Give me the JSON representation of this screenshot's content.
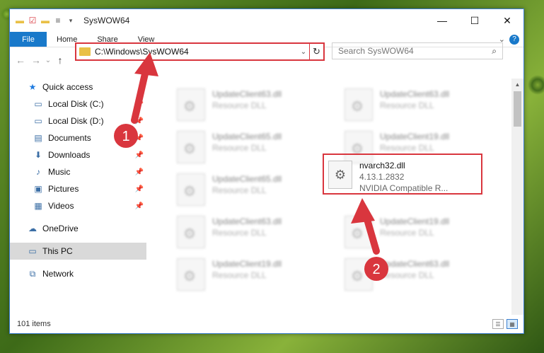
{
  "window": {
    "title": "SysWOW64"
  },
  "quick_access_toolbar": {
    "icons": [
      "folder-icon",
      "properties-check-icon",
      "new-folder-icon",
      "customize-dropdown-icon"
    ]
  },
  "window_controls": {
    "minimize": "—",
    "maximize": "☐",
    "close": "✕"
  },
  "ribbon": {
    "tabs": [
      "File",
      "Home",
      "Share",
      "View"
    ],
    "expand": "⌄",
    "help": "?"
  },
  "nav": {
    "back": "←",
    "forward": "→",
    "recent": "⌄",
    "up": "↑"
  },
  "address": {
    "path": "C:\\Windows\\SysWOW64",
    "dropdown": "⌄",
    "refresh": "↻"
  },
  "search": {
    "placeholder": "Search SysWOW64",
    "icon": "⌕"
  },
  "sidebar": {
    "items": [
      {
        "label": "Quick access",
        "icon": "star-icon",
        "glyph": "★",
        "color": "#1f7be0"
      },
      {
        "label": "Local Disk (C:)",
        "icon": "drive-icon",
        "glyph": "▭",
        "pinned": true
      },
      {
        "label": "Local Disk (D:)",
        "icon": "drive-icon",
        "glyph": "▭",
        "pinned": true
      },
      {
        "label": "Documents",
        "icon": "documents-icon",
        "glyph": "▤",
        "pinned": true
      },
      {
        "label": "Downloads",
        "icon": "download-icon",
        "glyph": "⬇",
        "pinned": true
      },
      {
        "label": "Music",
        "icon": "music-icon",
        "glyph": "♪",
        "pinned": true
      },
      {
        "label": "Pictures",
        "icon": "pictures-icon",
        "glyph": "▣",
        "pinned": true
      },
      {
        "label": "Videos",
        "icon": "videos-icon",
        "glyph": "▦",
        "pinned": true
      },
      {
        "label": "OneDrive",
        "icon": "cloud-icon",
        "glyph": "☁"
      },
      {
        "label": "This PC",
        "icon": "computer-icon",
        "glyph": "▭",
        "selected": true
      },
      {
        "label": "Network",
        "icon": "network-icon",
        "glyph": "⧉"
      }
    ]
  },
  "files": [
    {
      "name": "UpdateClient63.dll",
      "desc": "Resource DLL"
    },
    {
      "name": "UpdateClient63.dll",
      "desc": "Resource DLL"
    },
    {
      "name": "UpdateClient65.dll",
      "desc": "Resource DLL"
    },
    {
      "name": "UpdateClient19.dll",
      "desc": "Resource DLL"
    },
    {
      "name": "UpdateClient65.dll",
      "desc": "Resource DLL"
    },
    {
      "name": "UpdateClient63.dll",
      "desc": "Resource DLL"
    },
    {
      "name": "UpdateClient19.dll",
      "desc": "Resource DLL"
    },
    {
      "name": "UpdateClient19.dll",
      "desc": "Resource DLL"
    },
    {
      "name": "UpdateClient63.dll",
      "desc": "Resource DLL"
    }
  ],
  "highlighted_file": {
    "name": "nvarch32.dll",
    "version": "4.13.1.2832",
    "description": "NVIDIA Compatible R..."
  },
  "annotations": [
    {
      "label": "1"
    },
    {
      "label": "2"
    }
  ],
  "status": {
    "count": "101 items"
  },
  "colors": {
    "accent": "#1979ca",
    "annotation": "#d9363e"
  }
}
